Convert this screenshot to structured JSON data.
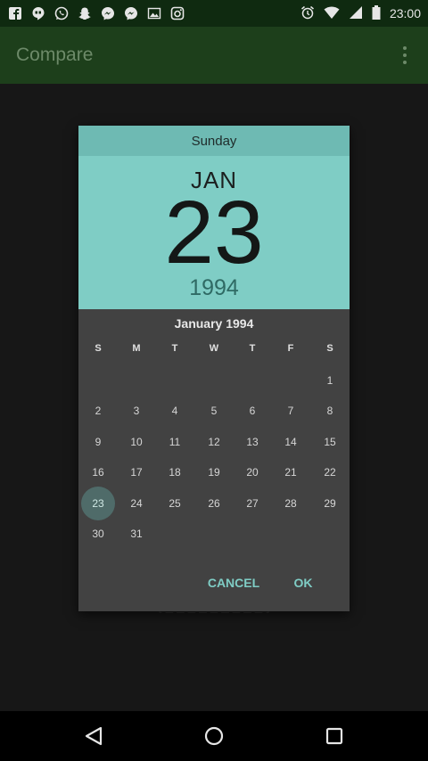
{
  "status_bar": {
    "time": "23:00",
    "left_icons": [
      "facebook-icon",
      "hangouts-icon",
      "whatsapp-icon",
      "snapchat-icon",
      "messenger-icon",
      "messenger-icon",
      "gallery-icon",
      "instagram-icon"
    ],
    "right_icons": [
      "alarm-icon",
      "wifi-icon",
      "signal-icon",
      "battery-icon"
    ]
  },
  "app_bar": {
    "title": "Compare"
  },
  "background": {
    "hint_text": "[ _ _ _ _ _ _ _ _ _ ]"
  },
  "date_picker": {
    "day_of_week": "Sunday",
    "month_short": "JAN",
    "day": "23",
    "year": "1994",
    "month_title": "January 1994",
    "weekday_labels": [
      "S",
      "M",
      "T",
      "W",
      "T",
      "F",
      "S"
    ],
    "first_weekday_index": 6,
    "days_in_month": 31,
    "selected_day": 23,
    "cancel_label": "CANCEL",
    "ok_label": "OK",
    "colors": {
      "accent": "#7fcdc5",
      "header_dark": "#6ebab3",
      "body": "#424242",
      "selected": "#4f6b69"
    }
  }
}
